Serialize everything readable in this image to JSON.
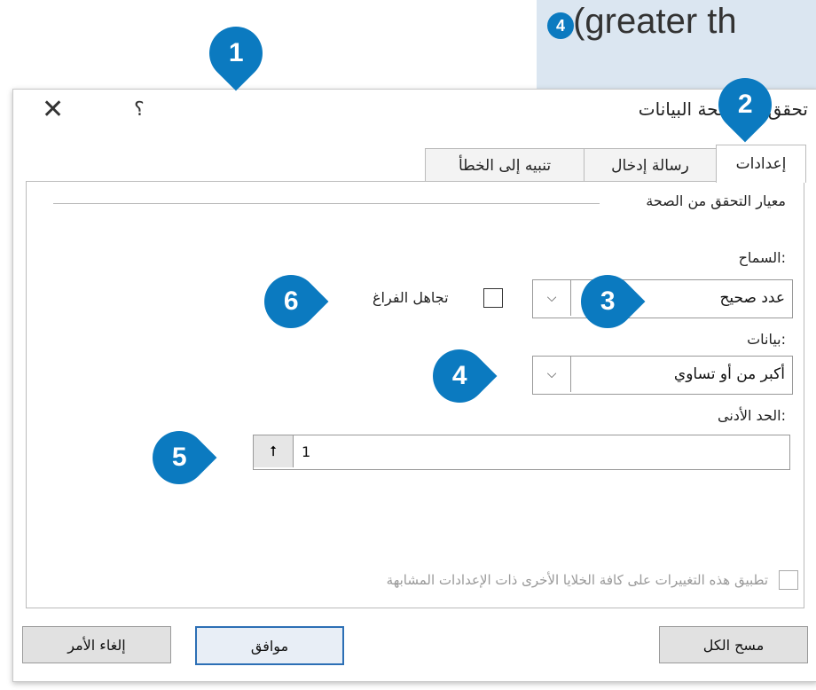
{
  "top_panel": {
    "caption": ".(greater th",
    "badge": "4"
  },
  "dialog": {
    "title": "تحقق من صحة البيانات",
    "close_glyph": "✕",
    "help_glyph": "؟",
    "tabs": [
      {
        "label": "إعدادات",
        "active": true
      },
      {
        "label": "رسالة إدخال",
        "active": false
      },
      {
        "label": "تنبيه إلى الخطأ",
        "active": false
      }
    ],
    "section_title": "معيار التحقق من الصحة",
    "allow": {
      "label": "السماح:",
      "value": "عدد صحيح"
    },
    "ignore_blank": {
      "label": "تجاهل الفراغ",
      "checked": false
    },
    "data": {
      "label": "بيانات:",
      "value": "أكبر من أو تساوي"
    },
    "minimum": {
      "label": "الحد الأدنى:",
      "value": "1",
      "button_glyph": "⭡"
    },
    "apply_all": {
      "label": "تطبيق هذه التغييرات على كافة الخلايا الأخرى ذات الإعدادات المشابهة",
      "checked": false
    },
    "buttons": {
      "clear_all": "مسح الكل",
      "ok": "موافق",
      "cancel": "إلغاء الأمر"
    },
    "dropdown_glyph": "⌵"
  },
  "callouts": [
    "1",
    "2",
    "3",
    "4",
    "5",
    "6"
  ],
  "colors": {
    "callout": "#0b7ac0",
    "panel": "#dbe6f1"
  }
}
